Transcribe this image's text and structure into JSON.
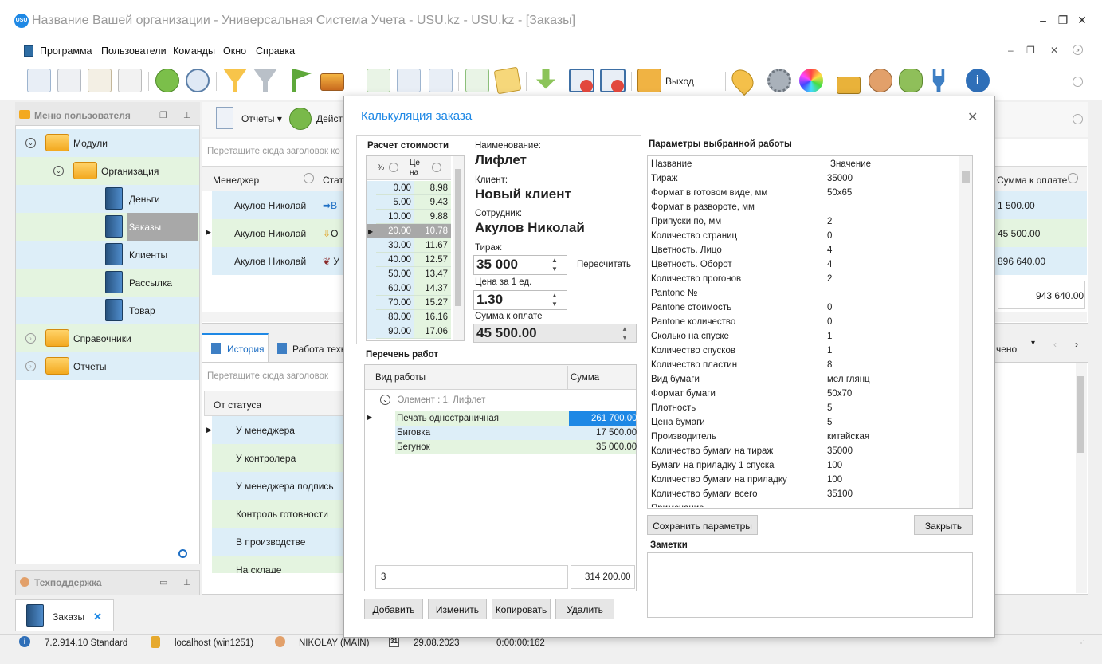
{
  "window": {
    "title": "Название Вашей организации - Универсальная Система Учета - USU.kz - USU.kz - [Заказы]",
    "logo_text": "USU"
  },
  "menu": [
    "Программа",
    "Пользователи",
    "Команды",
    "Окно",
    "Справка"
  ],
  "toolbar": {
    "exit_label": "Выход"
  },
  "subtoolbar": {
    "reports_label": "Отчеты",
    "actions_label": "Дейст"
  },
  "left_panel": {
    "title": "Меню пользователя",
    "tree": {
      "modules": "Модули",
      "organization": "Организация",
      "money": "Деньги",
      "orders": "Заказы",
      "clients": "Клиенты",
      "mailing": "Рассылка",
      "goods": "Товар",
      "references": "Справочники",
      "reports": "Отчеты"
    },
    "support": "Техподдержка"
  },
  "orders_grid": {
    "drag_hint": "Перетащите сюда заголовок ко",
    "col_manager": "Менеджер",
    "col_status": "Стат",
    "col_sum": "Сумма к оплате",
    "rows": [
      {
        "manager": "Акулов Николай",
        "status": "В",
        "sum": "1 500.00"
      },
      {
        "manager": "Акулов Николай",
        "status": "О",
        "sum": "45 500.00"
      },
      {
        "manager": "Акулов Николай",
        "status": "У",
        "sum": "896 640.00"
      }
    ],
    "total": "943 640.00"
  },
  "bottom_tabs": {
    "history": "История",
    "work": "Работа техн",
    "right_tab": "чено"
  },
  "history_grid": {
    "drag_hint": "Перетащите сюда заголовок",
    "col_from": "От статуса",
    "rows": [
      "У менеджера",
      "У контролера",
      "У менеджера подпись",
      "Контроль готовности",
      "В производстве",
      "На складе"
    ]
  },
  "orders_tab": {
    "label": "Заказы"
  },
  "status_bar": {
    "version": "7.2.914.10 Standard",
    "server": "localhost (win1251)",
    "user": "NIKOLAY (MAIN)",
    "date": "29.08.2023",
    "calendar_day": "31",
    "timer": "0:00:00:162"
  },
  "dialog": {
    "title": "Калькуляция заказа",
    "calc_title": "Расчет стоимости",
    "calc_cols": [
      "%",
      "Це на"
    ],
    "calc_rows": [
      [
        "0.00",
        "8.98"
      ],
      [
        "5.00",
        "9.43"
      ],
      [
        "10.00",
        "9.88"
      ],
      [
        "20.00",
        "10.78"
      ],
      [
        "30.00",
        "11.67"
      ],
      [
        "40.00",
        "12.57"
      ],
      [
        "50.00",
        "13.47"
      ],
      [
        "60.00",
        "14.37"
      ],
      [
        "70.00",
        "15.27"
      ],
      [
        "80.00",
        "16.16"
      ],
      [
        "90.00",
        "17.06"
      ]
    ],
    "name_label": "Наименование:",
    "name_value": "Лифлет",
    "client_label": "Клиент:",
    "client_value": "Новый клиент",
    "employee_label": "Сотрудник:",
    "employee_value": "Акулов Николай",
    "qty_label": "Тираж",
    "qty_value": "35 000",
    "recalc_label": "Пересчитать",
    "price_label": "Цена за 1 ед.",
    "price_value": "1.30",
    "total_label": "Сумма к оплате",
    "total_value": "45 500.00",
    "works_title": "Перечень работ",
    "works_col_type": "Вид работы",
    "works_col_sum": "Сумма",
    "works_group": "Элемент : 1. Лифлет",
    "works_rows": [
      {
        "type": "Печать одностраничная",
        "sum": "261 700.00"
      },
      {
        "type": "Биговка",
        "sum": "17 500.00"
      },
      {
        "type": "Бегунок",
        "sum": "35 000.00"
      }
    ],
    "works_count": "3",
    "works_total": "314 200.00",
    "buttons": {
      "add": "Добавить",
      "edit": "Изменить",
      "copy": "Копировать",
      "delete": "Удалить",
      "save_params": "Сохранить параметры",
      "close": "Закрыть"
    },
    "params_title": "Параметры выбранной работы",
    "params_col_name": "Название",
    "params_col_value": "Значение",
    "params": [
      [
        "Тираж",
        "35000"
      ],
      [
        "Формат в готовом виде, мм",
        "50x65"
      ],
      [
        "Формат в развороте, мм",
        ""
      ],
      [
        "Припуски по, мм",
        "2"
      ],
      [
        "Количество страниц",
        "0"
      ],
      [
        "Цветность. Лицо",
        "4"
      ],
      [
        "Цветность. Оборот",
        "4"
      ],
      [
        "Количество прогонов",
        "2"
      ],
      [
        "Pantone №",
        ""
      ],
      [
        "Pantone стоимость",
        "0"
      ],
      [
        "Pantone количество",
        "0"
      ],
      [
        "Сколько на спуске",
        "1"
      ],
      [
        "Количество спусков",
        "1"
      ],
      [
        "Количество пластин",
        "8"
      ],
      [
        "Вид бумаги",
        "мел глянц"
      ],
      [
        "Формат бумаги",
        "50x70"
      ],
      [
        "Плотность",
        "5"
      ],
      [
        "Цена бумаги",
        "5"
      ],
      [
        "Производитель",
        "китайская"
      ],
      [
        "Количество бумаги на тираж",
        "35000"
      ],
      [
        "Бумаги на приладку 1 спуска",
        "100"
      ],
      [
        "Количество бумаги на приладку",
        "100"
      ],
      [
        "Количество бумаги всего",
        "35100"
      ],
      [
        "Примечание",
        ""
      ]
    ],
    "notes_title": "Заметки"
  }
}
